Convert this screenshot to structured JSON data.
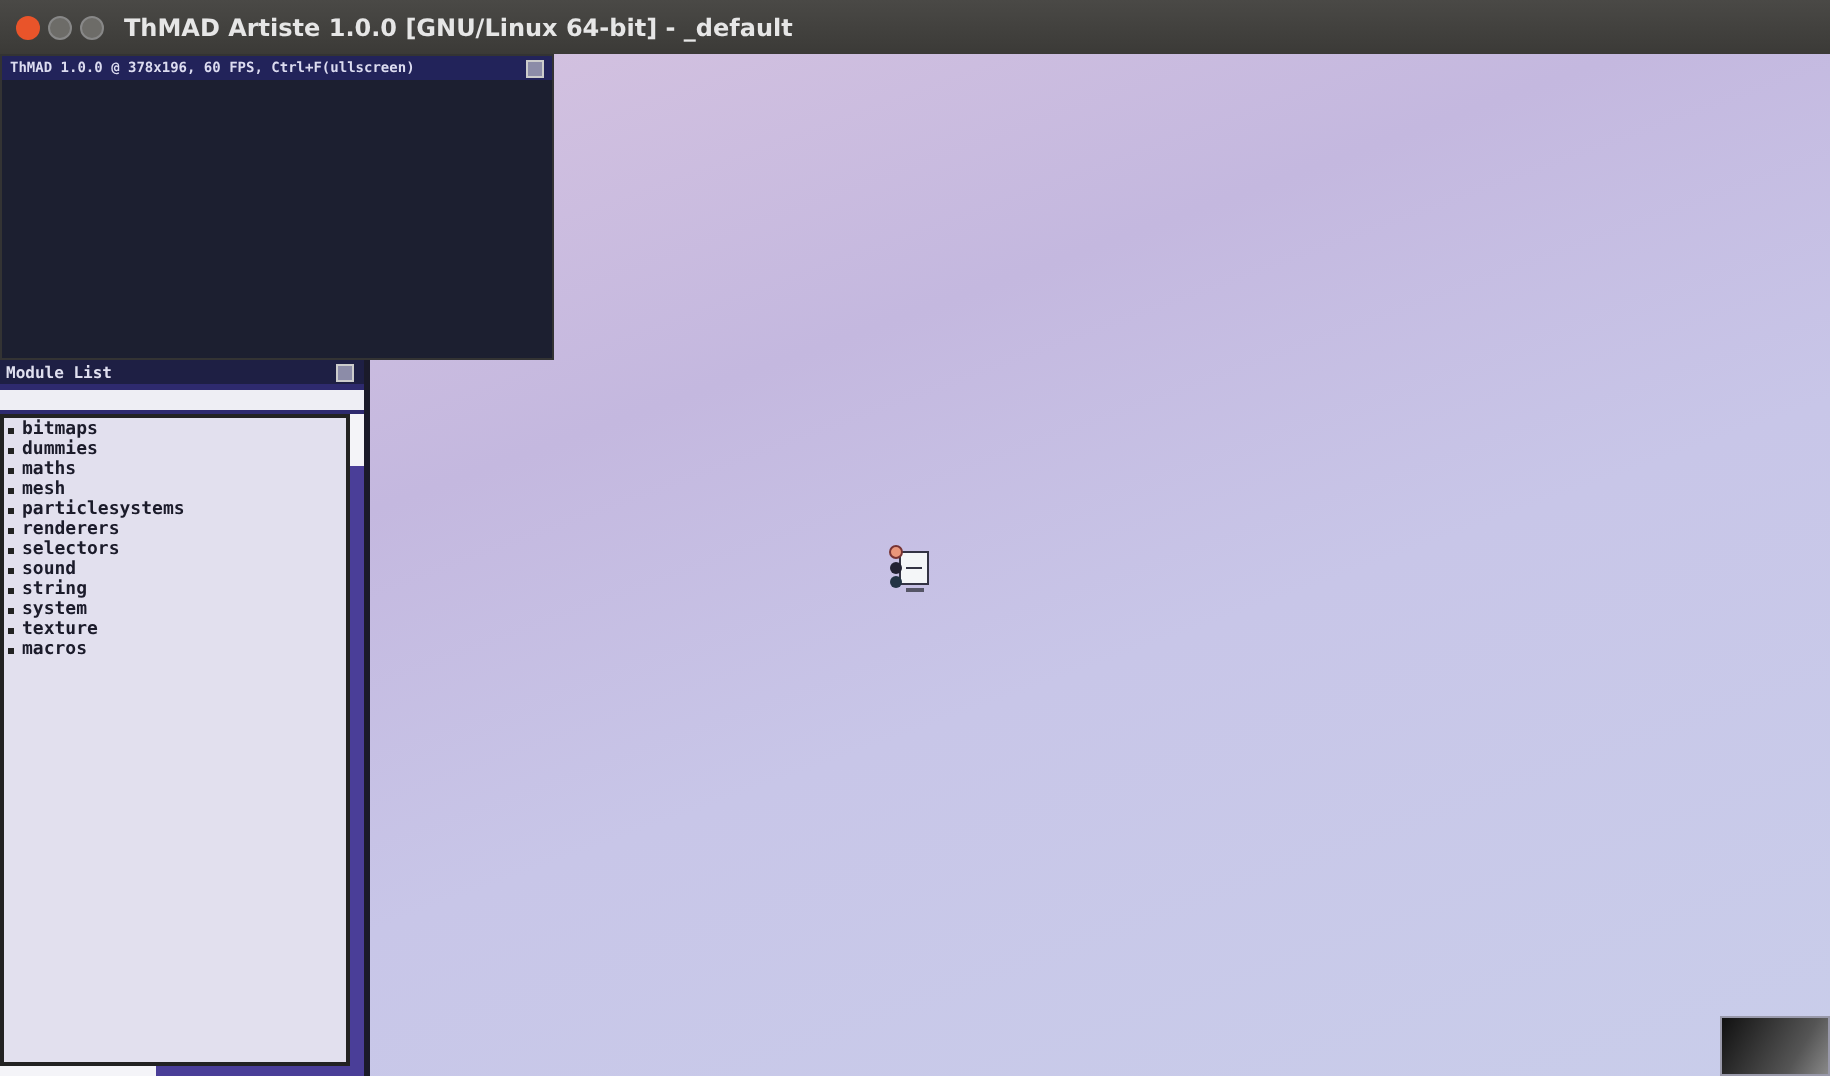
{
  "window": {
    "title": "ThMAD Artiste 1.0.0 [GNU/Linux 64-bit] - _default"
  },
  "preview": {
    "title": "ThMAD 1.0.0 @ 378x196, 60 FPS, Ctrl+F(ullscreen)"
  },
  "module_list": {
    "title": "Module List",
    "items": [
      {
        "label": "bitmaps"
      },
      {
        "label": "dummies"
      },
      {
        "label": "maths"
      },
      {
        "label": "mesh"
      },
      {
        "label": "particlesystems"
      },
      {
        "label": "renderers"
      },
      {
        "label": "selectors"
      },
      {
        "label": "sound"
      },
      {
        "label": "string"
      },
      {
        "label": "system"
      },
      {
        "label": "texture"
      },
      {
        "label": "macros"
      }
    ]
  }
}
